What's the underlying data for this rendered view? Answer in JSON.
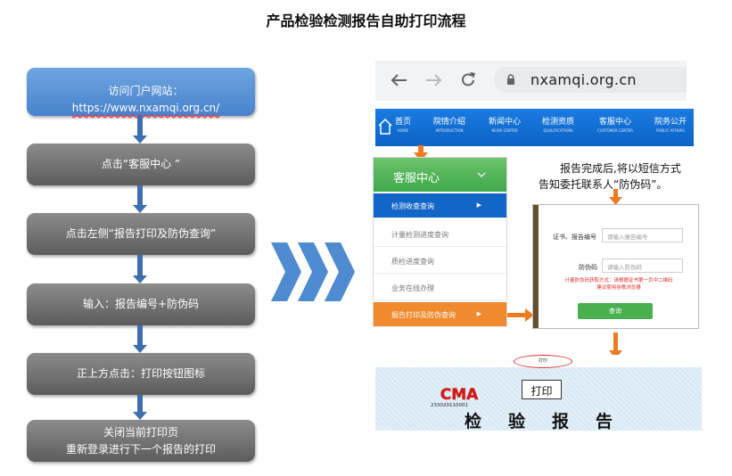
{
  "title": "产品检验检测报告自助打印流程",
  "flow": {
    "step1_prefix": "访问门户网站：",
    "step1_url": "https://www.nxamqi.org.cn/",
    "step2": "点击“客服中心 ”",
    "step3": "点击左侧“报告打印及防伪查询”",
    "step4": "输入：报告编号+防伪码",
    "step5": "正上方点击：打印按钮图标",
    "step6_line1": "关闭当前打印页",
    "step6_line2": "重新登录进行下一个报告的打印"
  },
  "browser": {
    "url": "nxamqi.org.cn"
  },
  "nav": [
    {
      "cn": "首页",
      "en": "HOME"
    },
    {
      "cn": "院情介绍",
      "en": "INTRODUCTION"
    },
    {
      "cn": "新闻中心",
      "en": "NEWS CENTER"
    },
    {
      "cn": "检测资质",
      "en": "QUALIFICATIONS"
    },
    {
      "cn": "客服中心",
      "en": "CUSTOMER CENTER"
    },
    {
      "cn": "院务公开",
      "en": "PUBLIC AFFAIRS"
    }
  ],
  "menu": {
    "header": "客服中心",
    "items": [
      "检测收查查询",
      "计量检测进度查询",
      "质检进度查询",
      "业务在线办理",
      "报告打印及防伪查询"
    ]
  },
  "note": {
    "line1": "报告完成后,将以短信方式",
    "line2": "告知委托联系人“防伪码”。"
  },
  "form": {
    "label_report": "证书、报告编号",
    "placeholder_report": "请输入报告编号",
    "label_code": "防伪码",
    "placeholder_code": "请输入防伪码",
    "red_line1": "计量防伪码获取方式：请根据证书第一页中二维码",
    "red_line2": "建议使用谷歌浏览器",
    "button": "查询"
  },
  "report": {
    "print_small": "打印",
    "cma_text": "CMA",
    "cma_number": "233020110001",
    "title": "检验报告",
    "print_label": "打印"
  },
  "colors": {
    "flow_blue": "#4782cc",
    "flow_gray": "#6e6e6e",
    "arrow_orange": "#f07a22",
    "nav_blue": "#0c63c6",
    "menu_green": "#3ea84a",
    "chevron_blue": "#4f8bd0"
  }
}
